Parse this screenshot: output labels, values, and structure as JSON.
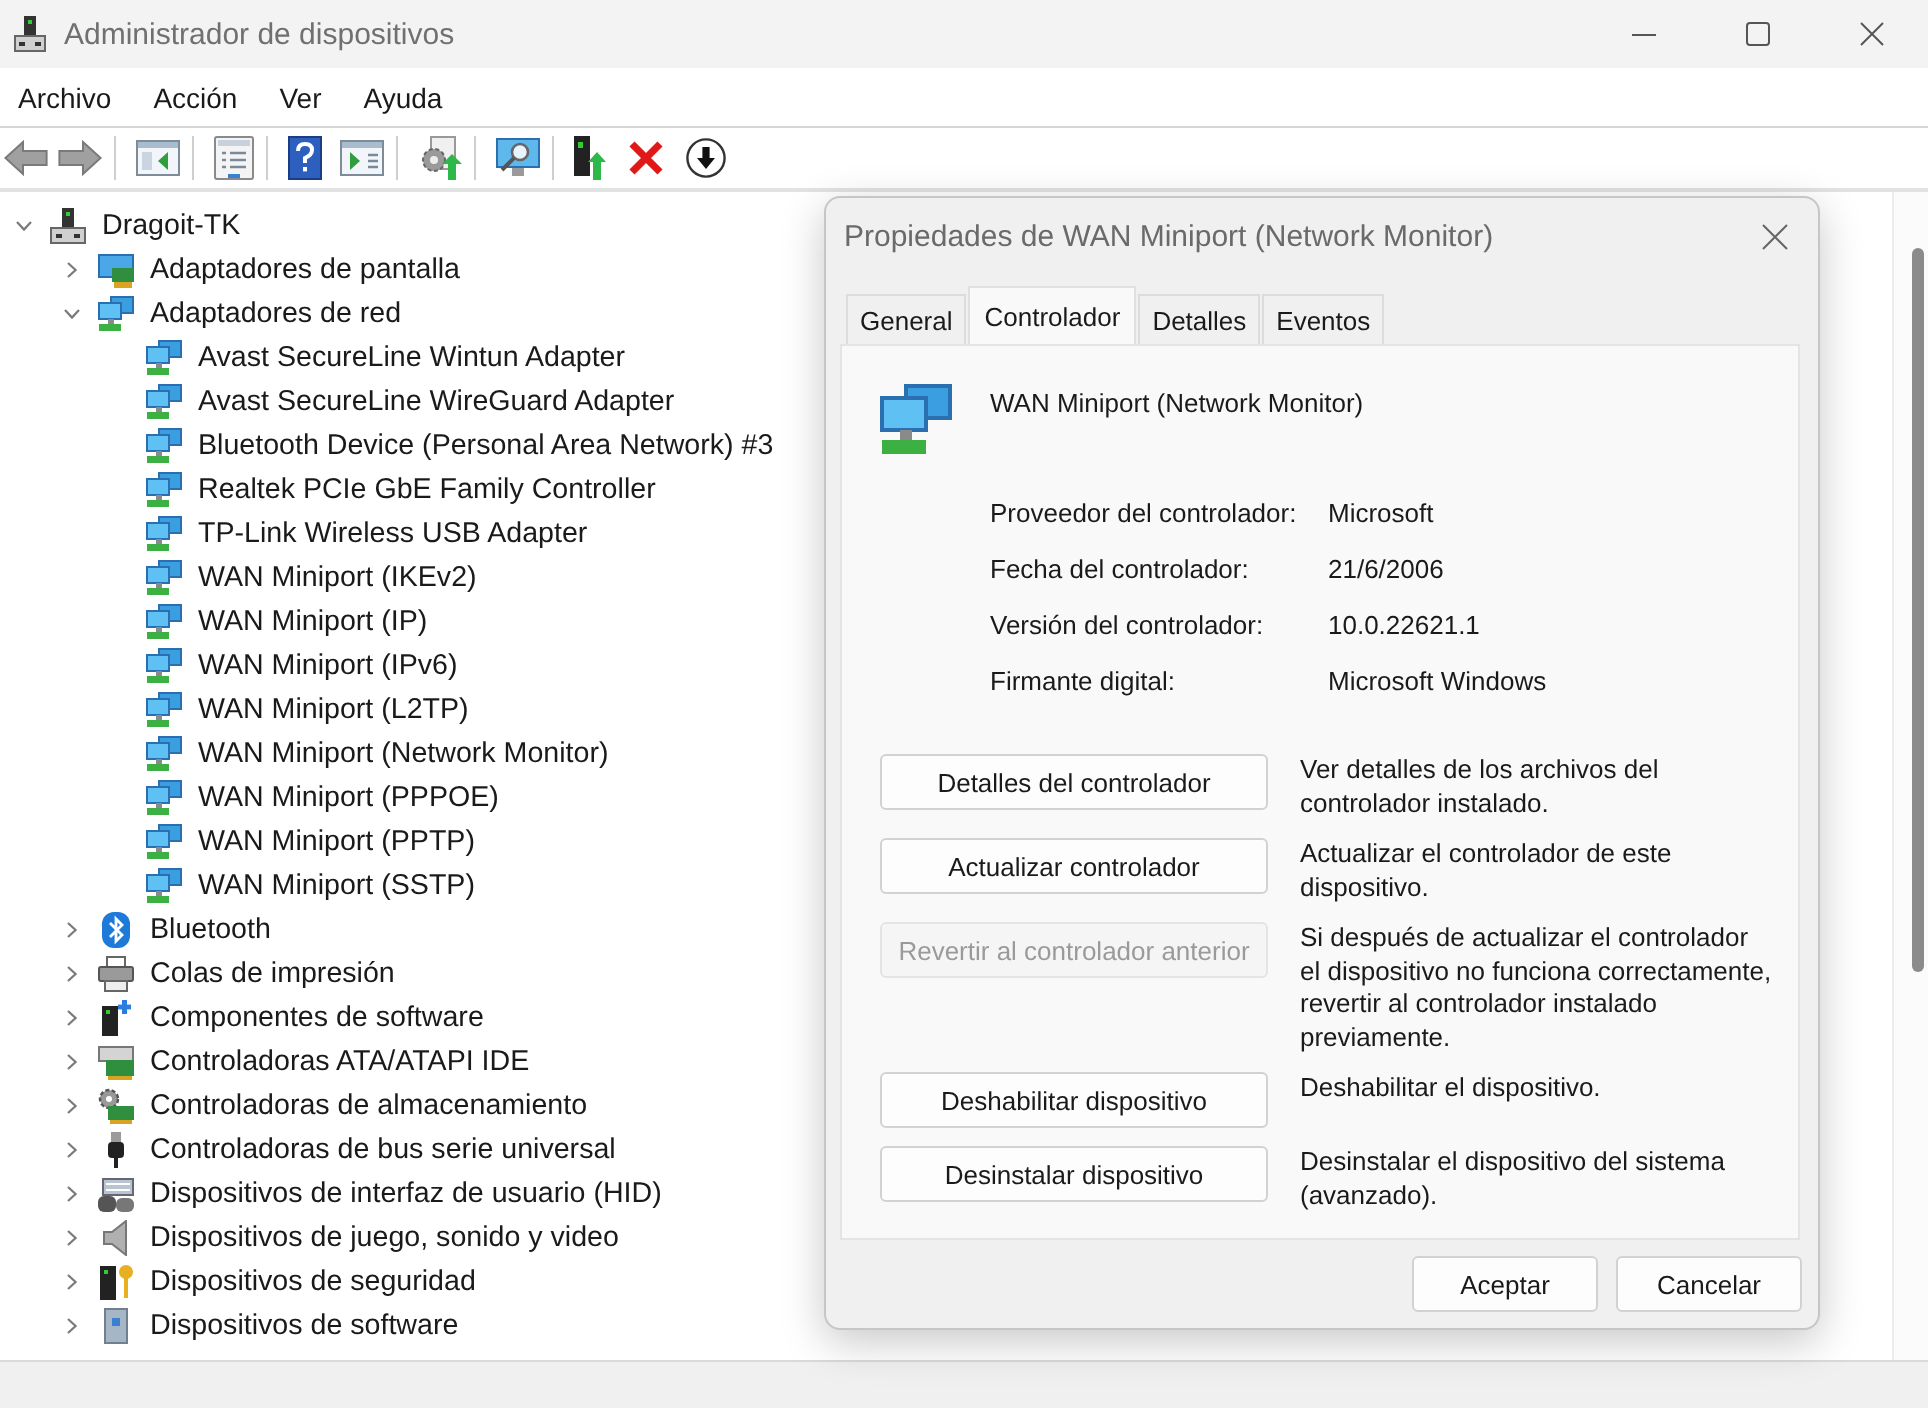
{
  "window": {
    "title": "Administrador de dispositivos"
  },
  "menu": [
    "Archivo",
    "Acción",
    "Ver",
    "Ayuda"
  ],
  "tree": [
    {
      "label": "Dragoit-TK",
      "kind": "computer",
      "expanded": true,
      "children": [
        {
          "label": "Adaptadores de pantalla",
          "kind": "display",
          "expanded": false
        },
        {
          "label": "Adaptadores de red",
          "kind": "network",
          "expanded": true,
          "children": [
            {
              "label": "Avast SecureLine Wintun Adapter",
              "kind": "network"
            },
            {
              "label": "Avast SecureLine WireGuard Adapter",
              "kind": "network"
            },
            {
              "label": "Bluetooth Device (Personal Area Network) #3",
              "kind": "network"
            },
            {
              "label": "Realtek PCIe GbE Family Controller",
              "kind": "network"
            },
            {
              "label": "TP-Link Wireless USB Adapter",
              "kind": "network"
            },
            {
              "label": "WAN Miniport (IKEv2)",
              "kind": "network"
            },
            {
              "label": "WAN Miniport (IP)",
              "kind": "network"
            },
            {
              "label": "WAN Miniport (IPv6)",
              "kind": "network"
            },
            {
              "label": "WAN Miniport (L2TP)",
              "kind": "network"
            },
            {
              "label": "WAN Miniport (Network Monitor)",
              "kind": "network"
            },
            {
              "label": "WAN Miniport (PPPOE)",
              "kind": "network"
            },
            {
              "label": "WAN Miniport (PPTP)",
              "kind": "network"
            },
            {
              "label": "WAN Miniport (SSTP)",
              "kind": "network"
            }
          ]
        },
        {
          "label": "Bluetooth",
          "kind": "bluetooth",
          "expanded": false
        },
        {
          "label": "Colas de impresión",
          "kind": "printer",
          "expanded": false
        },
        {
          "label": "Componentes de software",
          "kind": "component",
          "expanded": false
        },
        {
          "label": "Controladoras ATA/ATAPI IDE",
          "kind": "ide",
          "expanded": false
        },
        {
          "label": "Controladoras de almacenamiento",
          "kind": "storage",
          "expanded": false
        },
        {
          "label": "Controladoras de bus serie universal",
          "kind": "usb",
          "expanded": false
        },
        {
          "label": "Dispositivos de interfaz de usuario (HID)",
          "kind": "hid",
          "expanded": false
        },
        {
          "label": "Dispositivos de juego, sonido y video",
          "kind": "sound",
          "expanded": false
        },
        {
          "label": "Dispositivos de seguridad",
          "kind": "security",
          "expanded": false
        },
        {
          "label": "Dispositivos de software",
          "kind": "softwaredevice",
          "expanded": false
        }
      ]
    }
  ],
  "dialog": {
    "title": "Propiedades de WAN Miniport (Network Monitor)",
    "tabs": [
      {
        "label": "General",
        "selected": false
      },
      {
        "label": "Controlador",
        "selected": true
      },
      {
        "label": "Detalles",
        "selected": false
      },
      {
        "label": "Eventos",
        "selected": false
      }
    ],
    "device_name": "WAN Miniport (Network Monitor)",
    "properties": [
      {
        "label": "Proveedor del controlador:",
        "value": "Microsoft"
      },
      {
        "label": "Fecha del controlador:",
        "value": "21/6/2006"
      },
      {
        "label": "Versión del controlador:",
        "value": "10.0.22621.1"
      },
      {
        "label": "Firmante digital:",
        "value": "Microsoft Windows"
      }
    ],
    "actions": [
      {
        "label": "Detalles del controlador",
        "description": "Ver detalles de los archivos del controlador instalado.",
        "disabled": false
      },
      {
        "label": "Actualizar controlador",
        "description": "Actualizar el controlador de este dispositivo.",
        "disabled": false
      },
      {
        "label": "Revertir al controlador anterior",
        "description": "Si después de actualizar el controlador el dispositivo no funciona correctamente, revertir al controlador instalado previamente.",
        "disabled": true
      },
      {
        "label": "Deshabilitar dispositivo",
        "description": "Deshabilitar el dispositivo.",
        "disabled": false
      },
      {
        "label": "Desinstalar dispositivo",
        "description": "Desinstalar el dispositivo del sistema (avanzado).",
        "disabled": false
      }
    ],
    "buttons": [
      "Aceptar",
      "Cancelar"
    ]
  }
}
